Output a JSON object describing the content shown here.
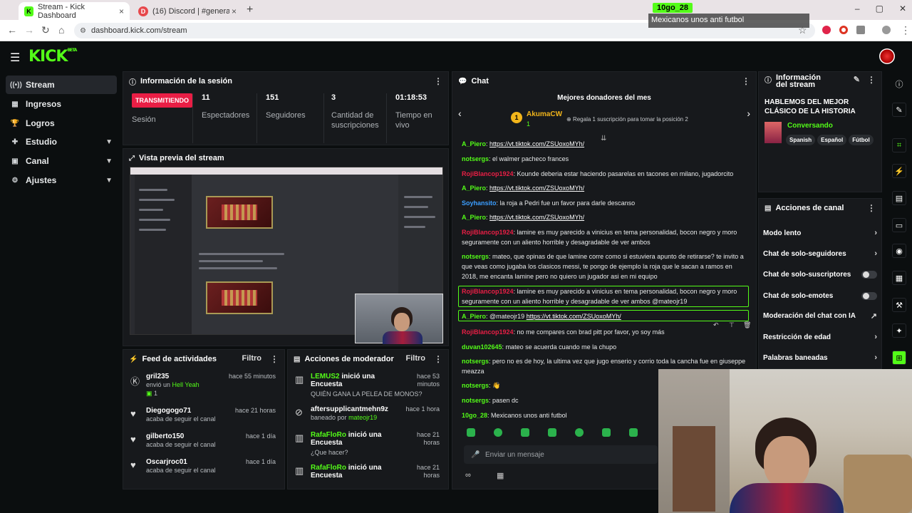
{
  "browser": {
    "tabs": [
      {
        "title": "Stream - Kick Dashboard",
        "icon": "K"
      },
      {
        "title": "(16) Discord | #general | M",
        "icon": "D"
      }
    ],
    "url": "dashboard.kick.com/stream"
  },
  "notification": {
    "user": "10go_28",
    "message": "Mexicanos unos anti futbol"
  },
  "sidebar": {
    "items": [
      {
        "label": "Stream",
        "icon": "stream-icon"
      },
      {
        "label": "Ingresos",
        "icon": "money-icon"
      },
      {
        "label": "Logros",
        "icon": "trophy-icon"
      },
      {
        "label": "Estudio",
        "icon": "studio-icon"
      },
      {
        "label": "Canal",
        "icon": "channel-icon"
      },
      {
        "label": "Ajustes",
        "icon": "gear-icon"
      }
    ]
  },
  "session": {
    "title": "Información de la sesión",
    "status": "TRANSMITIENDO",
    "status_label": "Sesión",
    "stats": [
      {
        "value": "11",
        "label": "Espectadores"
      },
      {
        "value": "151",
        "label": "Seguidores"
      },
      {
        "value": "3",
        "label": "Cantidad de suscripciones"
      },
      {
        "value": "01:18:53",
        "label": "Tiempo en vivo"
      }
    ]
  },
  "preview": {
    "title": "Vista previa del stream"
  },
  "activity": {
    "title": "Feed de actividades",
    "filter": "Filtro",
    "rows": [
      {
        "name": "gril235",
        "sub": "envió un",
        "extra": "Hell Yeah",
        "count": "1",
        "time": "hace 55 minutos"
      },
      {
        "name": "Diegogogo71",
        "sub": "acaba de seguir el canal",
        "time": "hace 21 horas"
      },
      {
        "name": "gilberto150",
        "sub": "acaba de seguir el canal",
        "time": "hace 1 día"
      },
      {
        "name": "Oscarjroc01",
        "sub": "acaba de seguir el canal",
        "time": "hace 1 día"
      }
    ]
  },
  "modactions": {
    "title": "Acciones de moderador",
    "filter": "Filtro",
    "rows": [
      {
        "name": "LEMUS2",
        "action": "inició una Encuesta",
        "sub": "QUIÉN GANA LA PELEA DE MONOS?",
        "time": "hace 53 minutos"
      },
      {
        "name": "aftersupplicantmehn9z",
        "action": "",
        "sub": "baneado por",
        "by": "mateojr19",
        "time": "hace 1 hora"
      },
      {
        "name": "RafaFloRo",
        "action": "inició una Encuesta",
        "sub": "¿Que hacer?",
        "time": "hace 21 horas"
      },
      {
        "name": "RafaFloRo",
        "action": "inició una Encuesta",
        "sub": "",
        "time": "hace 21 horas"
      }
    ]
  },
  "chat": {
    "title": "Chat",
    "donors_title": "Mejores donadores del mes",
    "top_donor": "AkumaCW",
    "top_donor_count": "1",
    "donor_hint": "Regala 1 suscripción para tomar la posición 2",
    "messages": [
      {
        "user": "A_Piero",
        "color": "green",
        "text": "",
        "link": "https://vt.tiktok.com/ZSUoxoMYh/"
      },
      {
        "user": "notsergs",
        "color": "green",
        "text": "el walmer pacheco frances",
        "link": ""
      },
      {
        "user": "RojiBlancop1924",
        "color": "red",
        "text": "Kounde deberia estar haciendo pasarelas en tacones en milano, jugadorcito",
        "link": ""
      },
      {
        "user": "A_Piero",
        "color": "green",
        "text": "",
        "link": "https://vt.tiktok.com/ZSUoxoMYh/"
      },
      {
        "user": "Soyhansito",
        "color": "blue",
        "text": "la roja a Pedri fue un favor para darle descanso",
        "link": ""
      },
      {
        "user": "A_Piero",
        "color": "green",
        "text": "",
        "link": "https://vt.tiktok.com/ZSUoxoMYh/"
      },
      {
        "user": "RojiBlancop1924",
        "color": "red",
        "text": "lamine es muy parecido a vinicius en tema personalidad, bocon negro y moro seguramente con un aliento horrible y desagradable de ver ambos",
        "link": ""
      },
      {
        "user": "notsergs",
        "color": "green",
        "text": "mateo, que opinas de que lamine corre como si estuviera apunto de retirarse? te invito a que veas como jugaba los clasicos messi, te pongo de ejemplo la roja que le sacan a ramos en 2018, me encanta lamine pero no quiero un jugador asi en mi equipo",
        "link": ""
      },
      {
        "user": "RojiBlancop1924",
        "color": "red",
        "text": "lamine es muy parecido a vinicius en tema personalidad, bocon negro y moro seguramente con un aliento horrible y desagradable de ver ambos @mateojr19",
        "link": ""
      },
      {
        "user": "A_Piero",
        "color": "green",
        "text": "@mateojr19",
        "link": "https://vt.tiktok.com/ZSUoxoMYh/"
      },
      {
        "user": "RojiBlancop1924",
        "color": "red",
        "text": "no me compares con brad pitt por favor, yo soy más",
        "link": ""
      },
      {
        "user": "duvan102645",
        "color": "green",
        "text": "mateo se acuerda cuando me la chupo",
        "link": ""
      },
      {
        "user": "notsergs",
        "color": "green",
        "text": "pero no es de hoy, la ultima vez que jugo enserio y corrio toda la cancha fue en giuseppe meazza",
        "link": ""
      },
      {
        "user": "notsergs",
        "color": "green",
        "text": "👋",
        "link": ""
      },
      {
        "user": "notsergs",
        "color": "green",
        "text": "pasen dc",
        "link": ""
      },
      {
        "user": "10go_28",
        "color": "green",
        "text": "Mexicanos unos anti futbol",
        "link": ""
      }
    ],
    "input_placeholder": "Enviar un mensaje"
  },
  "stream_info": {
    "title": "Información del stream",
    "stream_title": "HABLEMOS DEL MEJOR CLÁSICO DE LA HISTORIA",
    "category": "Conversando",
    "tags": [
      "Spanish",
      "Español",
      "Fútbol"
    ]
  },
  "channel_actions": {
    "title": "Acciones de canal",
    "rows": [
      {
        "label": "Modo lento",
        "kind": "arrow"
      },
      {
        "label": "Chat de solo-seguidores",
        "kind": "arrow"
      },
      {
        "label": "Chat de solo-suscriptores",
        "kind": "toggle"
      },
      {
        "label": "Chat de solo-emotes",
        "kind": "toggle"
      },
      {
        "label": "Moderación del chat con IA",
        "kind": "chart"
      },
      {
        "label": "Restricción de edad",
        "kind": "arrow"
      },
      {
        "label": "Palabras baneadas",
        "kind": "arrow"
      }
    ]
  },
  "colors": {
    "accent": "#53fc18",
    "live": "#e91e45",
    "panel": "#17191c"
  }
}
